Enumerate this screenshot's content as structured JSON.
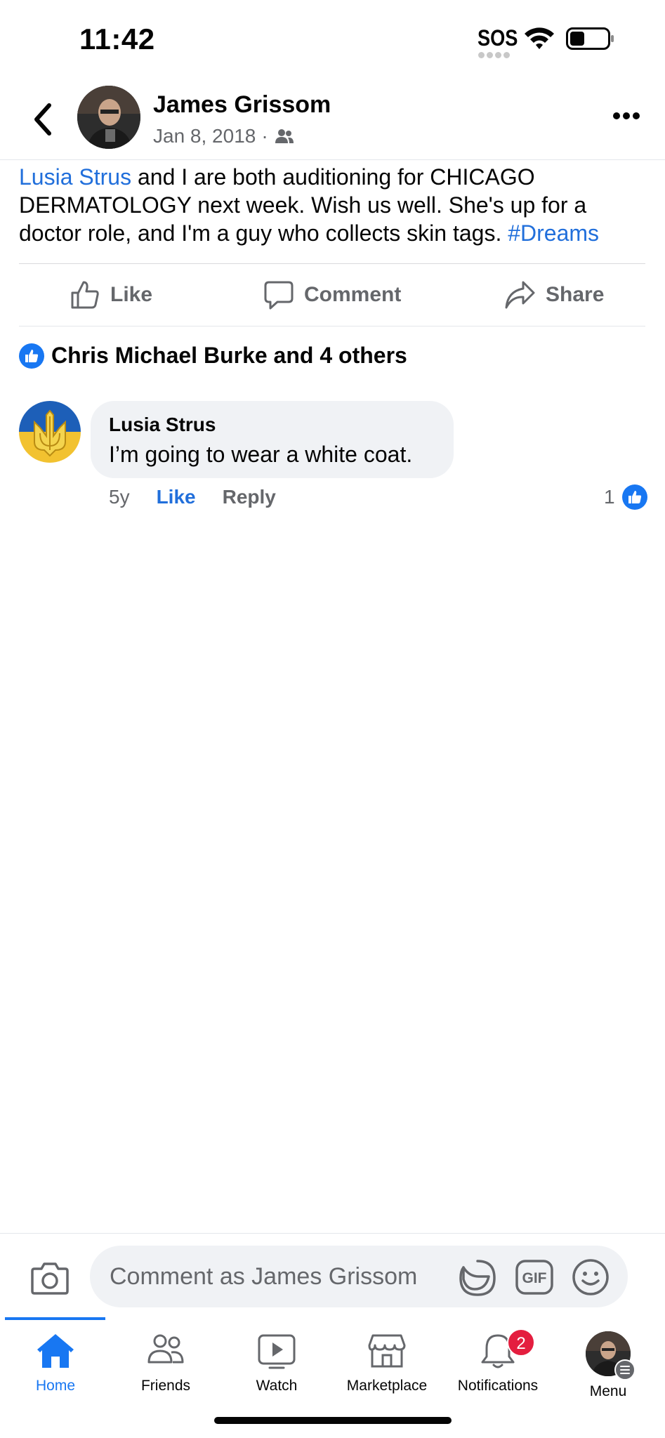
{
  "status_bar": {
    "time": "11:42",
    "sos": "SOS"
  },
  "post": {
    "author_name": "James Grissom",
    "date": "Jan 8, 2018",
    "audience_icon": "friends-icon",
    "text_link": "Lusia Strus",
    "text_body": " and I are both auditioning for CHICAGO DERMATOLOGY next week. Wish us well. She's up for a doctor role, and I'm a guy who collects skin tags. ",
    "hashtag": "#Dreams"
  },
  "actions": {
    "like": "Like",
    "comment": "Comment",
    "share": "Share"
  },
  "reactions": {
    "summary": "Chris Michael Burke and 4 others"
  },
  "comment": {
    "author": "Lusia Strus",
    "text": "I’m going to wear a white coat.",
    "age": "5y",
    "like_label": "Like",
    "reply_label": "Reply",
    "like_count": "1"
  },
  "composer": {
    "placeholder": "Comment as James Grissom",
    "gif_label": "GIF"
  },
  "nav": {
    "home": "Home",
    "friends": "Friends",
    "watch": "Watch",
    "marketplace": "Marketplace",
    "notifications": "Notifications",
    "notifications_badge": "2",
    "menu": "Menu"
  },
  "colors": {
    "accent": "#1877f2",
    "link": "#216fdb",
    "badge": "#e41e3f",
    "secondary_text": "#65676b"
  }
}
